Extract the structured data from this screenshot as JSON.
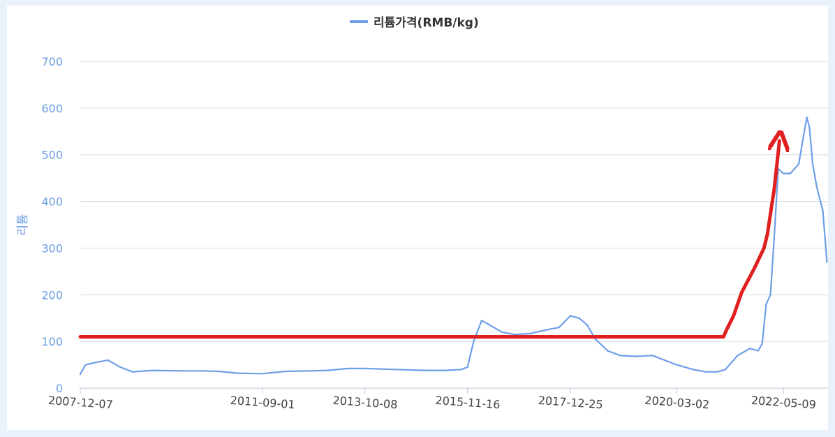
{
  "chart_data": {
    "type": "line",
    "title": "",
    "ylabel": "리튬",
    "xlabel": "",
    "ylim": [
      0,
      700
    ],
    "yticks": [
      0,
      100,
      200,
      300,
      400,
      500,
      600,
      700
    ],
    "x_ticks": [
      "2007-12-07",
      "2011-09-01",
      "2013-10-08",
      "2015-11-16",
      "2017-12-25",
      "2020-03-02",
      "2022-05-09"
    ],
    "legend_position": "top-center",
    "grid": true,
    "colors": {
      "series": "#6d9ee8",
      "annotation": "#e02020"
    },
    "series": [
      {
        "name": "리튬가격(RMB/kg)",
        "x": [
          "2007-12-07",
          "2008-01-15",
          "2008-04-01",
          "2008-07-01",
          "2008-10-01",
          "2009-01-01",
          "2009-06-01",
          "2010-01-01",
          "2010-06-01",
          "2010-10-01",
          "2011-03-01",
          "2011-09-01",
          "2012-03-01",
          "2012-09-01",
          "2013-01-01",
          "2013-06-01",
          "2013-10-08",
          "2014-06-01",
          "2015-01-01",
          "2015-06-01",
          "2015-10-01",
          "2015-11-16",
          "2016-01-01",
          "2016-03-01",
          "2016-05-01",
          "2016-08-01",
          "2016-11-01",
          "2017-03-01",
          "2017-07-01",
          "2017-10-01",
          "2017-12-25",
          "2018-03-01",
          "2018-05-01",
          "2018-07-01",
          "2018-10-01",
          "2019-01-01",
          "2019-05-01",
          "2019-09-01",
          "2019-12-01",
          "2020-03-02",
          "2020-07-01",
          "2020-10-01",
          "2021-01-01",
          "2021-03-01",
          "2021-06-01",
          "2021-09-01",
          "2021-11-01",
          "2021-12-01",
          "2022-01-01",
          "2022-02-01",
          "2022-03-01",
          "2022-04-01",
          "2022-05-09",
          "2022-07-01",
          "2022-09-01",
          "2022-11-01",
          "2022-11-20",
          "2022-12-15",
          "2023-01-15",
          "2023-03-01",
          "2023-04-01"
        ],
        "values": [
          30,
          50,
          55,
          60,
          45,
          35,
          38,
          37,
          37,
          36,
          32,
          31,
          36,
          37,
          38,
          42,
          42,
          40,
          38,
          38,
          40,
          45,
          100,
          145,
          135,
          120,
          115,
          117,
          125,
          130,
          155,
          150,
          135,
          105,
          80,
          70,
          68,
          70,
          60,
          50,
          40,
          35,
          35,
          40,
          70,
          85,
          80,
          95,
          180,
          200,
          320,
          470,
          460,
          460,
          480,
          580,
          560,
          480,
          430,
          380,
          270
        ]
      }
    ],
    "annotation": {
      "type": "hand-drawn arrow",
      "color": "#e02020",
      "baseline_value": 110,
      "baseline_from": "2007-12-07",
      "baseline_to": "2021-02-15",
      "arrow_path_dates": [
        "2021-02-15",
        "2021-03-10",
        "2021-05-01",
        "2021-07-01",
        "2021-10-01",
        "2021-12-15",
        "2022-01-10",
        "2022-02-10",
        "2022-03-01",
        "2022-04-10"
      ],
      "arrow_path_values": [
        110,
        125,
        155,
        205,
        255,
        300,
        330,
        390,
        425,
        530
      ]
    }
  }
}
